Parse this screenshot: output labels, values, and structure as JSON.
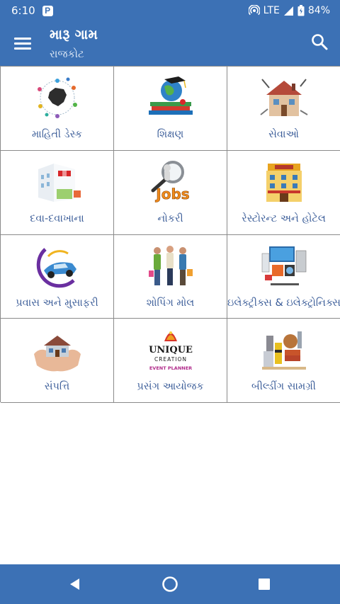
{
  "status_bar": {
    "time": "6:10",
    "app_badge": "P",
    "network": "LTE",
    "battery": "84%"
  },
  "app_bar": {
    "title": "મારૂ ગામ",
    "subtitle": "રાજકોટ",
    "icons": [
      "menu-icon",
      "search-icon"
    ]
  },
  "grid": {
    "items": [
      {
        "label": "માહિતી ડેસ્ક",
        "icon": "info-desk-icon"
      },
      {
        "label": "શિક્ષણ",
        "icon": "education-icon"
      },
      {
        "label": "સેવાઓ",
        "icon": "services-icon"
      },
      {
        "label": "દવા-દવાખાના",
        "icon": "hospital-icon"
      },
      {
        "label": "નોકરી",
        "icon": "jobs-icon"
      },
      {
        "label": "રેસ્ટોરન્ટ અને હોટેલ",
        "icon": "restaurant-hotel-icon"
      },
      {
        "label": "પ્રવાસ અને મુસાફરી",
        "icon": "travel-icon"
      },
      {
        "label": "શોપિંગ મોલ",
        "icon": "shopping-mall-icon"
      },
      {
        "label": "ઇલેક્ટ્રીક્સ & ઇલેક્ટ્રોનિક્સ",
        "icon": "electronics-icon"
      },
      {
        "label": "સંપત્તિ",
        "icon": "property-icon"
      },
      {
        "label": "પ્રસંગ આયોજક",
        "icon": "event-planner-icon"
      },
      {
        "label": "બીલ્ડીંગ સામગ્રી",
        "icon": "building-material-icon"
      }
    ],
    "logo_text": {
      "jobs": "Jobs",
      "event_brand_line1": "UNIQUE",
      "event_brand_line2": "CREATION",
      "event_brand_line3": "EVENT PLANNER"
    }
  },
  "nav_bar": {
    "icons": [
      "back-icon",
      "home-icon",
      "recents-icon"
    ]
  },
  "colors": {
    "primary": "#3c71b5",
    "label": "#3a5c98",
    "grid_line": "#8a8a8a"
  }
}
